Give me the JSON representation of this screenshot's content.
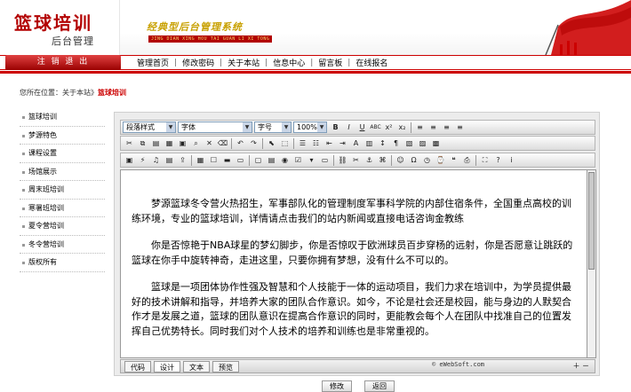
{
  "header": {
    "logo_title": "篮球培训",
    "logo_sub": "后台管理",
    "slogan": "经典型后台管理系统",
    "slogan_sub": "JING DIAN XING HOU TAI GUAN LI XI TONG"
  },
  "logout_label": "注 销 退 出",
  "nav": [
    "管理首页",
    "修改密码",
    "关于本站",
    "信息中心",
    "留言板",
    "在线报名"
  ],
  "crumb": {
    "prefix": "您所在位置：关于本站",
    "arrow": "》",
    "current": "篮球培训"
  },
  "sidebar": [
    "篮球培训",
    "梦源特色",
    "课程设置",
    "场馆展示",
    "周末班培训",
    "寒暑班培训",
    "夏令营培训",
    "冬令营培训",
    "版权所有"
  ],
  "toolbar": {
    "style": "段落样式",
    "font": "字体",
    "size": "字号",
    "zoom": "100%"
  },
  "content": {
    "p1": "梦源篮球冬令营火热招生，军事部队化的管理制度军事科学院的内部住宿条件，全国重点高校的训练环境，专业的篮球培训，详情请点击我们的站内新闻或直接电话咨询金教练",
    "p2": "你是否惊艳于NBA球星的梦幻脚步，你是否惊叹于欧洲球员百步穿杨的远射，你是否愿意让跳跃的篮球在你手中旋转神奇，走进这里，只要你拥有梦想，没有什么不可以的。",
    "p3": "篮球是一项团体协作性强及智慧和个人技能于一体的运动项目，我们力求在培训中，为学员提供最好的技术讲解和指导，并培养大家的团队合作意识。如今，不论是社会还是校园，能与身边的人默契合作才是发展之道，篮球的团队意识在提高合作意识的同时，更能教会每个人在团队中找准自己的位置发挥自己优势特长。同时我们对个人技术的培养和训练也是非常重视的。"
  },
  "tabs": [
    "代码",
    "设计",
    "文本",
    "预览"
  ],
  "copyright": "© eWebSoft.com",
  "buttons": {
    "modify": "修改",
    "back": "返回"
  }
}
